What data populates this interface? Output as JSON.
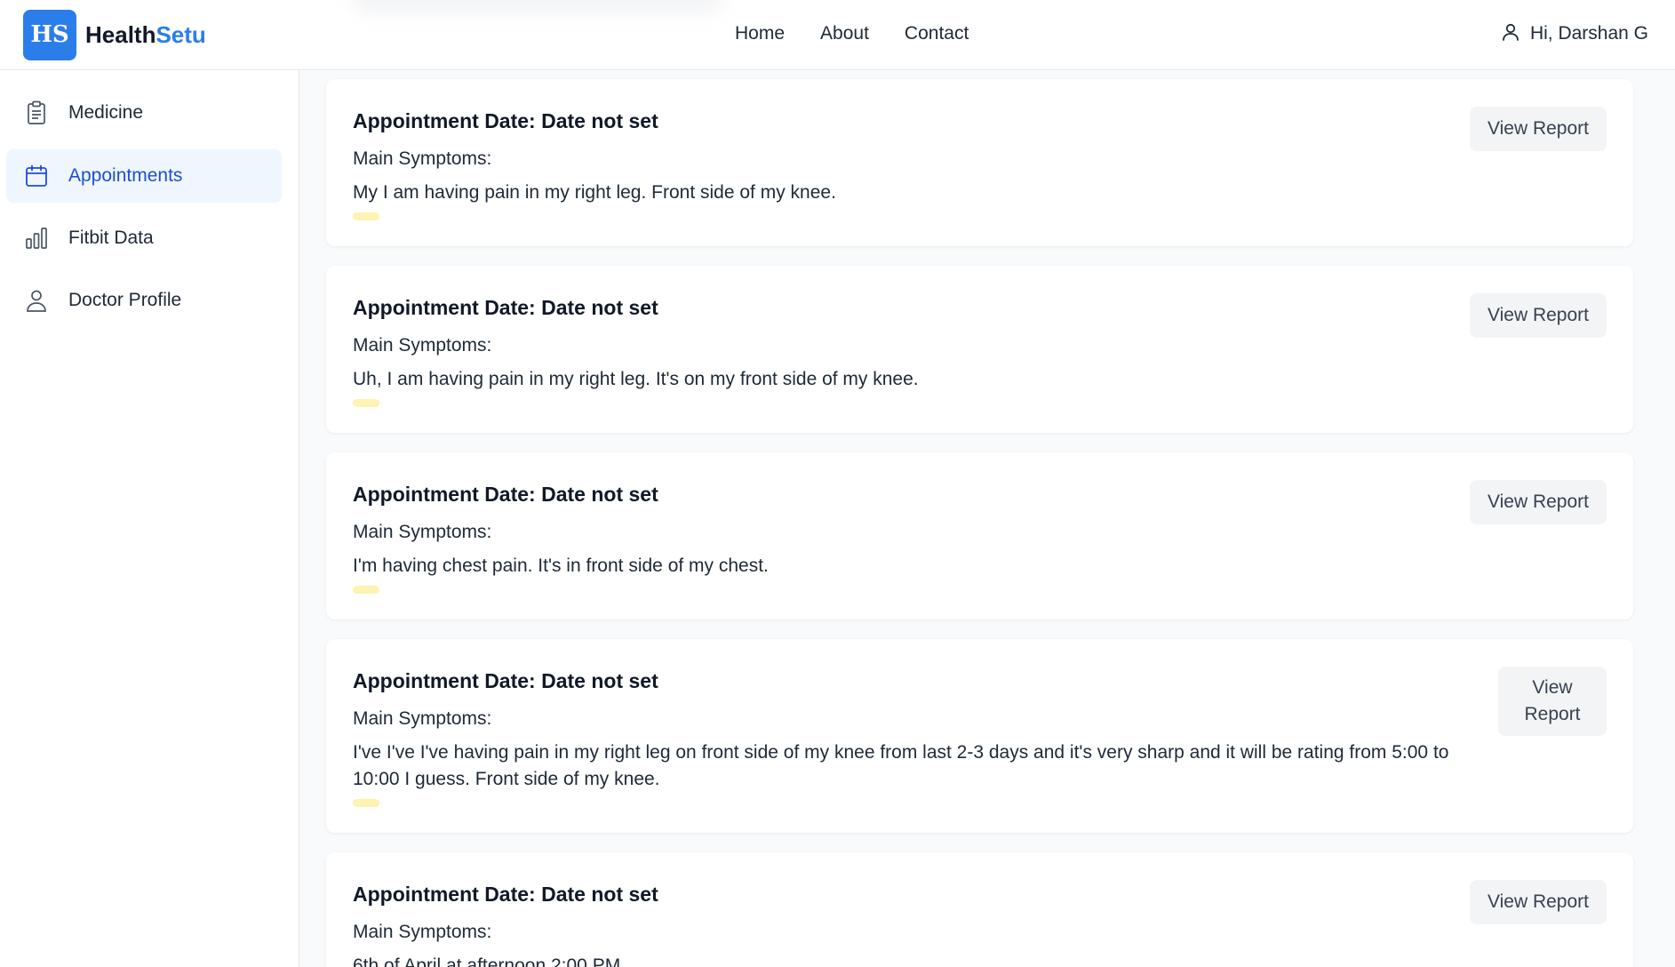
{
  "brand": {
    "logo_text": "HS",
    "name_part1": "Health",
    "name_part2": "Setu",
    "accent_color": "#2b7de9"
  },
  "nav": {
    "home": "Home",
    "about": "About",
    "contact": "Contact"
  },
  "user": {
    "greeting": "Hi, Darshan G",
    "icon": "user-icon"
  },
  "sidebar": {
    "items": [
      {
        "label": "Medicine",
        "icon": "clipboard-icon",
        "active": false
      },
      {
        "label": "Appointments",
        "icon": "calendar-icon",
        "active": true
      },
      {
        "label": "Fitbit Data",
        "icon": "bar-chart-icon",
        "active": false
      },
      {
        "label": "Doctor Profile",
        "icon": "user-icon",
        "active": false
      }
    ]
  },
  "appointments": [
    {
      "date": "Appointment Date: Date not set",
      "symptoms_label": "Main Symptoms:",
      "symptoms": "My I am having pain in my right leg. Front side of my knee.",
      "button": "View Report"
    },
    {
      "date": "Appointment Date: Date not set",
      "symptoms_label": "Main Symptoms:",
      "symptoms": "Uh, I am having pain in my right leg. It's on my front side of my knee.",
      "button": "View Report"
    },
    {
      "date": "Appointment Date: Date not set",
      "symptoms_label": "Main Symptoms:",
      "symptoms": "I'm having chest pain. It's in front side of my chest.",
      "button": "View Report"
    },
    {
      "date": "Appointment Date: Date not set",
      "symptoms_label": "Main Symptoms:",
      "symptoms": "I've I've I've having pain in my right leg on front side of my knee from last 2-3 days and it's very sharp and it will be rating from 5:00 to 10:00 I guess. Front side of my knee.",
      "button": "View Report"
    },
    {
      "date": "Appointment Date: Date not set",
      "symptoms_label": "Main Symptoms:",
      "symptoms": "6th of April at afternoon 2:00 PM",
      "button": "View Report"
    }
  ]
}
